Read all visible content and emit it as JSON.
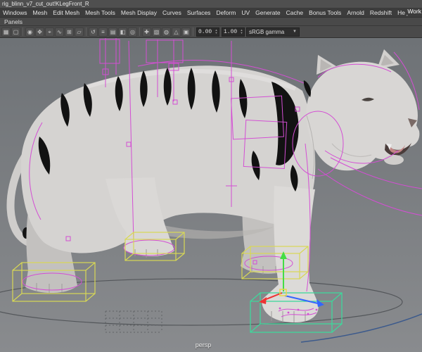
{
  "window": {
    "title": "rig_blinn_v7_cut_out!KLegFront_R",
    "workspace_label": "Work"
  },
  "menu_bar": {
    "items": [
      "Windows",
      "Mesh",
      "Edit Mesh",
      "Mesh Tools",
      "Mesh Display",
      "Curves",
      "Surfaces",
      "Deform",
      "UV",
      "Generate",
      "Cache",
      "Bonus Tools",
      "Arnold",
      "Redshift",
      "Help"
    ]
  },
  "panels_bar": {
    "label": "Panels"
  },
  "viewport_toolbar": {
    "icons": [
      {
        "name": "menu-grid-icon",
        "glyph": "▦"
      },
      {
        "name": "marquee-select-icon",
        "glyph": "▢"
      },
      {
        "name": "target-icon",
        "glyph": "◉"
      },
      {
        "name": "move-tool-icon",
        "glyph": "✥"
      },
      {
        "name": "snap-point-icon",
        "glyph": "⌖"
      },
      {
        "name": "snap-curve-icon",
        "glyph": "∿"
      },
      {
        "name": "snap-grid-icon",
        "glyph": "⊞"
      },
      {
        "name": "snap-plane-icon",
        "glyph": "▱"
      },
      {
        "name": "history-icon",
        "glyph": "↺"
      },
      {
        "name": "list-menu-icon",
        "glyph": "≡"
      },
      {
        "name": "shading-icon",
        "glyph": "▤"
      },
      {
        "name": "side-panel-icon",
        "glyph": "◧"
      },
      {
        "name": "camera-icon",
        "glyph": "◎"
      },
      {
        "name": "add-icon",
        "glyph": "✚"
      },
      {
        "name": "texture-icon",
        "glyph": "▧"
      },
      {
        "name": "light-icon",
        "glyph": "◍"
      },
      {
        "name": "cone-icon",
        "glyph": "△"
      },
      {
        "name": "render-view-icon",
        "glyph": "▣"
      }
    ],
    "exposure_value": "0.00",
    "gamma_value": "1.00",
    "view_transform": "sRGB gamma",
    "dropdown_arrow": "▼",
    "spinner_up": "▲",
    "spinner_down": "▼"
  },
  "viewport": {
    "camera_label": "persp"
  },
  "colors": {
    "rig_curve": "#d44ed4",
    "selection_box": "#d8d855",
    "selected_box": "#3fd79c",
    "manip_x": "#ee3333",
    "manip_y": "#44dd44",
    "manip_z": "#3366ff"
  }
}
